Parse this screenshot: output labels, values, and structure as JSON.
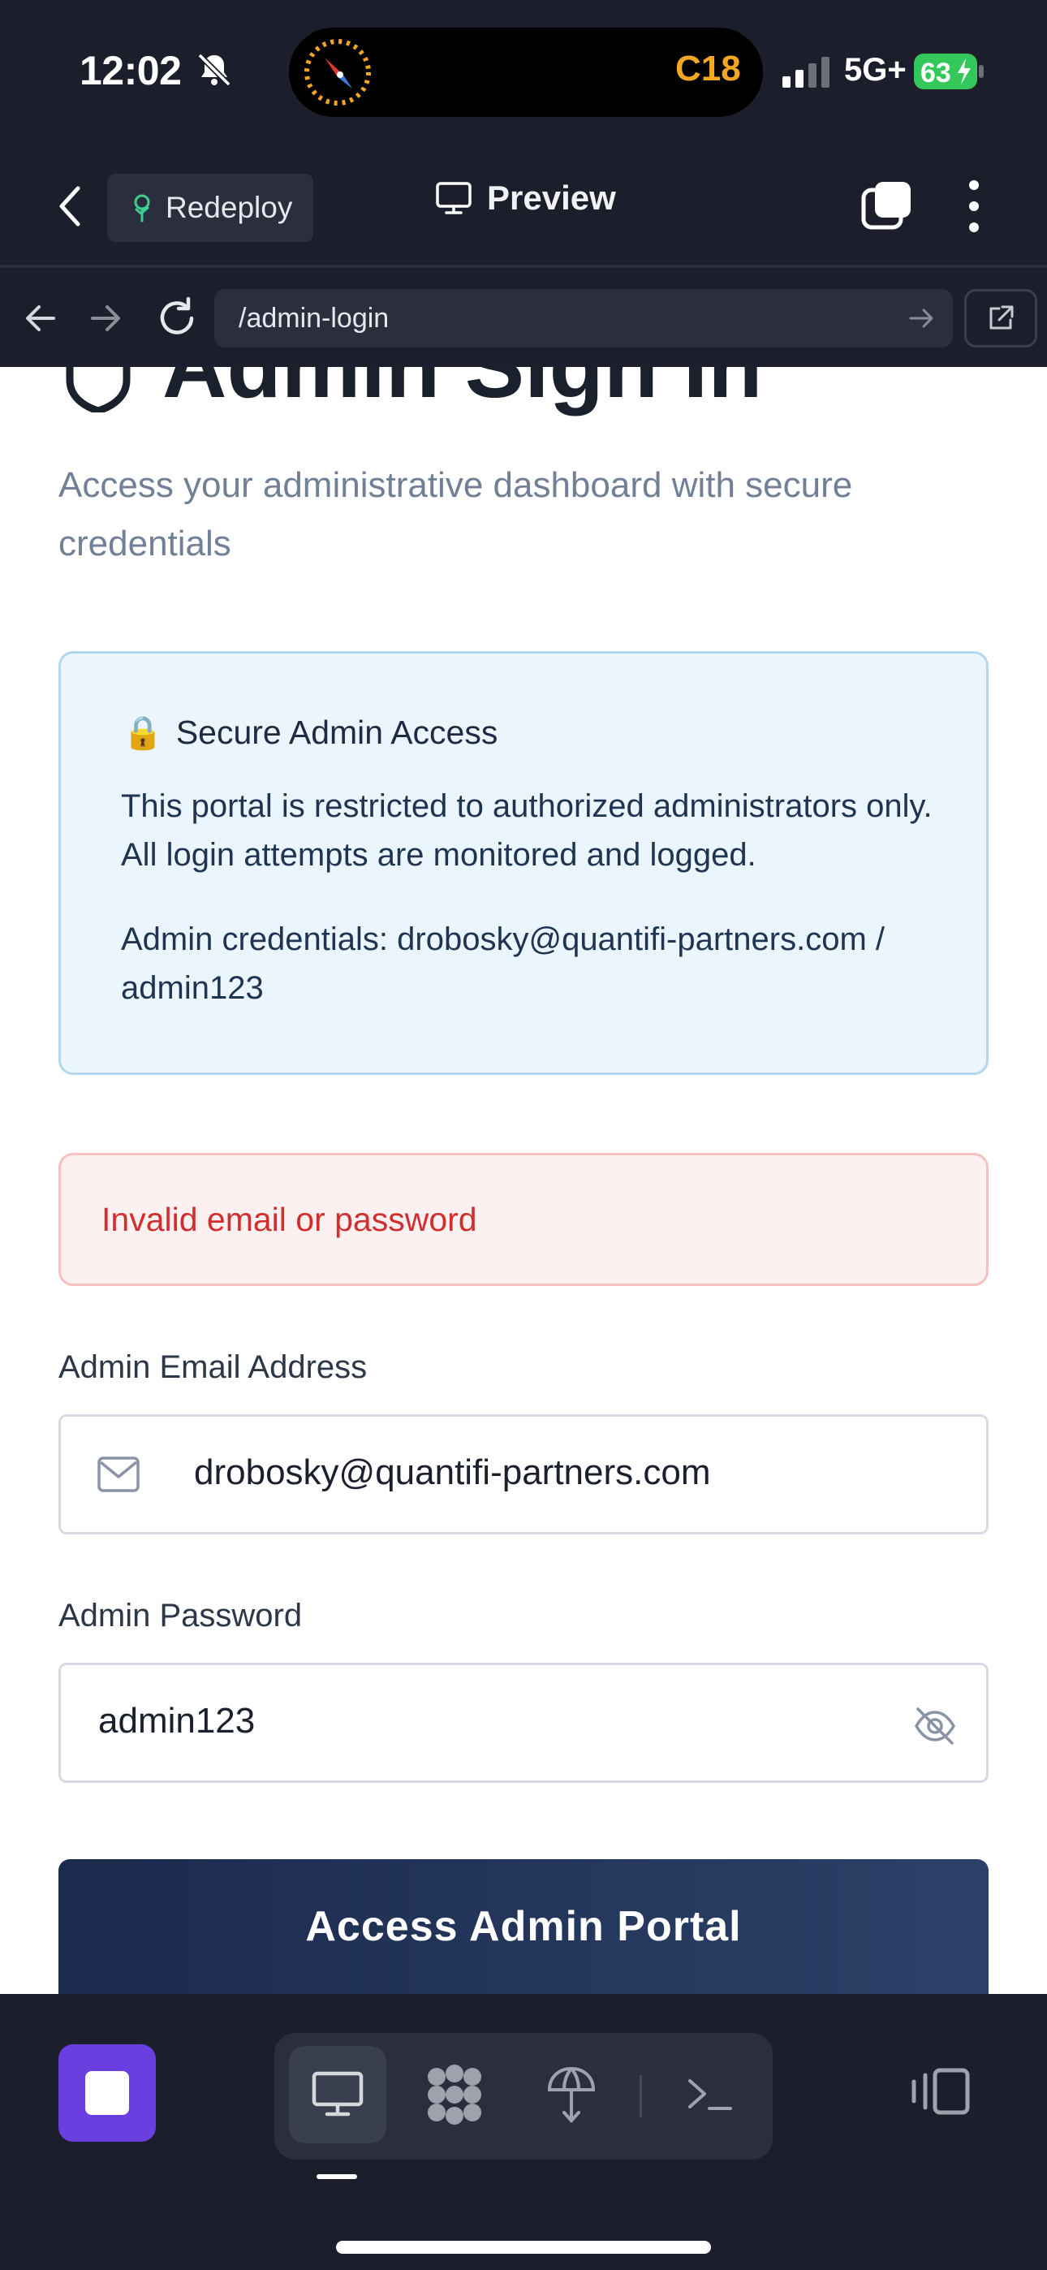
{
  "status_bar": {
    "time": "12:02",
    "live_activity_code": "C18",
    "network": "5G+",
    "battery": "63"
  },
  "app_header": {
    "redeploy_label": "Redeploy",
    "preview_label": "Preview"
  },
  "browser": {
    "url": "/admin-login"
  },
  "page": {
    "title": "Admin Sign In",
    "subtitle": "Access your administrative dashboard with secure credentials",
    "info": {
      "emoji": "🔒",
      "heading": "Secure Admin Access",
      "text": "This portal is restricted to authorized administrators only. All login attempts are monitored and logged.",
      "credentials": "Admin credentials: drobosky@quantifi-partners.com / admin123"
    },
    "error": "Invalid email or password",
    "email_label": "Admin Email Address",
    "email_value": "drobosky@quantifi-partners.com",
    "password_label": "Admin Password",
    "password_value": "admin123",
    "submit_label": "Access Admin Portal"
  },
  "colors": {
    "accent": "#6b3fdf",
    "error": "#d12f2f",
    "button": "#1b2a4d",
    "live_activity": "#f5a623",
    "battery": "#34c759"
  },
  "icons": [
    "bell-slash-icon",
    "compass-icon",
    "signal-icon",
    "battery-icon",
    "back-icon",
    "tree-icon",
    "monitor-icon",
    "tabs-icon",
    "kebab-icon",
    "arrow-left-icon",
    "arrow-right-icon",
    "reload-icon",
    "external-link-icon",
    "shield-icon",
    "lock-icon",
    "mail-icon",
    "eye-off-icon",
    "stop-icon",
    "desktop-icon",
    "nodes-icon",
    "deploy-icon",
    "terminal-icon",
    "panels-icon"
  ]
}
